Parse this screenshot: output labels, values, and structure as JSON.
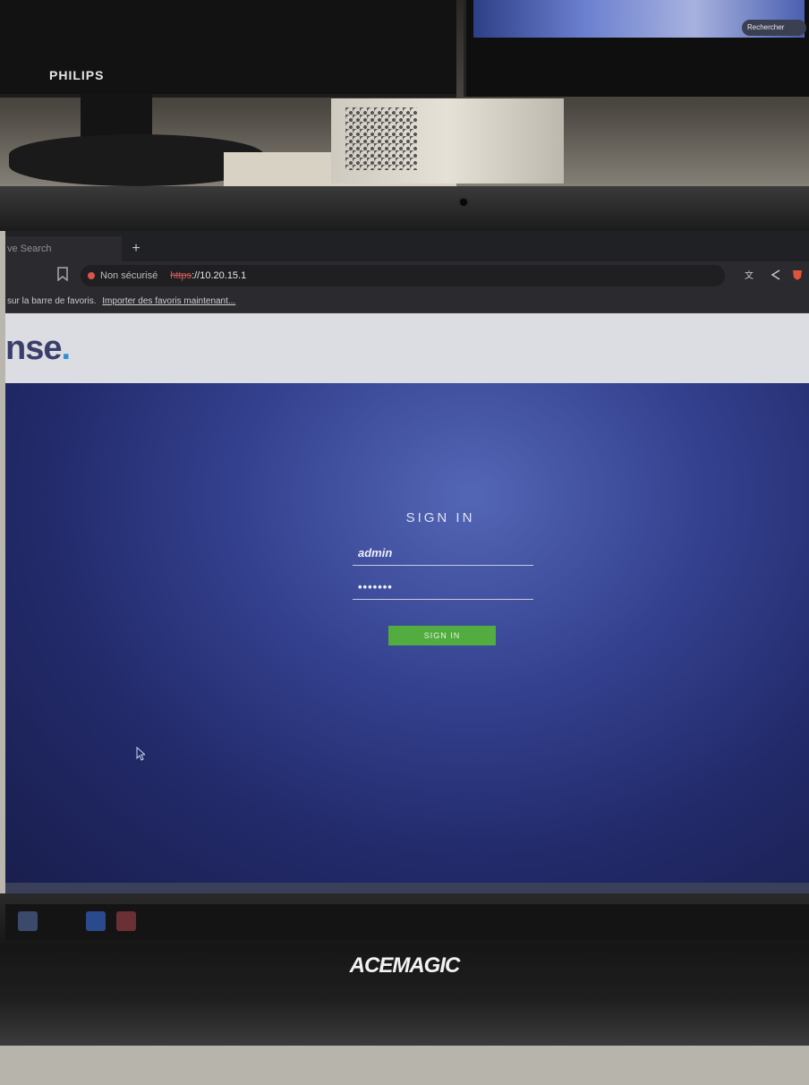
{
  "background": {
    "monitor_brand": "PHILIPS",
    "search_label": "Rechercher",
    "laptop_brand": "ACEMAGIC"
  },
  "browser": {
    "tab_title": "ve Search",
    "new_tab_symbol": "+",
    "security_status": "Non sécurisé",
    "url_scheme": "https",
    "url_rest": "://10.20.15.1",
    "bookmarks_text": "sur la barre de favoris.",
    "bookmarks_link": "Importer des favoris maintenant..."
  },
  "page": {
    "brand_text": "nse",
    "brand_dot": ".",
    "login": {
      "title": "SIGN IN",
      "username_value": "admin",
      "password_value": "•••••••",
      "submit_label": "SIGN IN"
    }
  },
  "icons": {
    "bookmark": "bookmark-icon",
    "warning": "warning-icon",
    "translate": "translate-icon",
    "share": "share-icon",
    "brave": "brave-lion-icon",
    "cursor": "mouse-cursor-icon"
  },
  "colors": {
    "signin_button": "#52ac3f",
    "page_background": "#34418f",
    "header_background": "#dcdde2",
    "insecure_warning": "#d9534f"
  }
}
